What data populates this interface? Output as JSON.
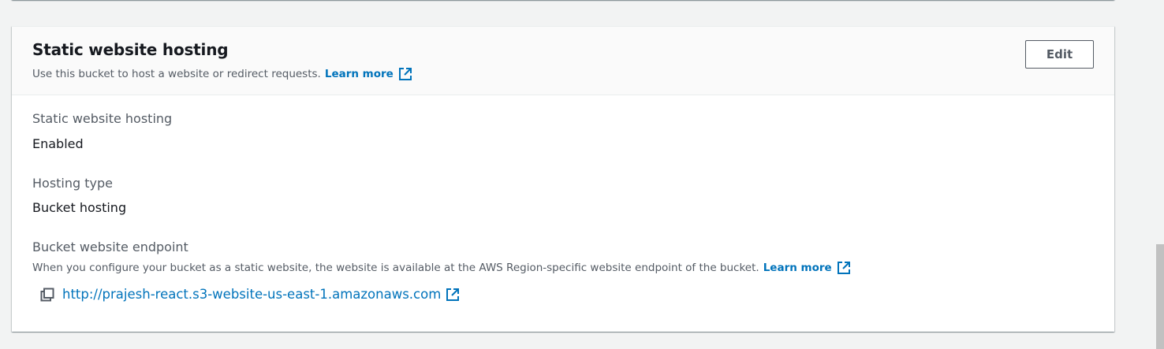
{
  "panel": {
    "title": "Static website hosting",
    "description": "Use this bucket to host a website or redirect requests.",
    "learn_more": "Learn more",
    "edit_label": "Edit"
  },
  "fields": {
    "hosting_label": "Static website hosting",
    "hosting_value": "Enabled",
    "type_label": "Hosting type",
    "type_value": "Bucket hosting",
    "endpoint_label": "Bucket website endpoint",
    "endpoint_desc": "When you configure your bucket as a static website, the website is available at the AWS Region-specific website endpoint of the bucket.",
    "endpoint_learn_more": "Learn more",
    "endpoint_url": "http://prajesh-react.s3-website-us-east-1.amazonaws.com"
  },
  "icons": {
    "external_link": "external-link-icon",
    "copy": "copy-icon"
  },
  "colors": {
    "link": "#0073bb",
    "text": "#16191f",
    "secondary_text": "#545b64",
    "background": "#f2f3f3",
    "header_background": "#fafafa"
  }
}
